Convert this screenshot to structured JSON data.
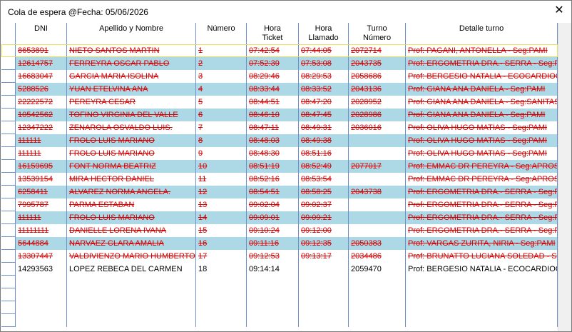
{
  "window": {
    "title": "Cola de espera @Fecha: 05/06/2026",
    "close_glyph": "✕"
  },
  "columns": [
    "DNI",
    "Apellido y Nombre",
    "Número",
    "Hora\nTicket",
    "Hora\nLlamado",
    "Turno\nNúmero",
    "Detalle turno"
  ],
  "rows": [
    {
      "dni": "8653891",
      "nombre": "NIETO SANTOS MARTIN",
      "numero": "1",
      "ticket": "07:42:54",
      "llamado": "07:44:05",
      "turno": "2072714",
      "detalle": "Prof: PAGANI, ANTONELLA - Seg:PAMI",
      "style": "white",
      "status": "cancel",
      "selected": true
    },
    {
      "dni": "12614757",
      "nombre": "FERREYRA OSCAR PABLO",
      "numero": "2",
      "ticket": "07:52:39",
      "llamado": "07:53:08",
      "turno": "2043735",
      "detalle": "Prof: ERGOMETRIA DRA.- SERRA - Seg:PAM",
      "style": "blue",
      "status": "cancel"
    },
    {
      "dni": "16683047",
      "nombre": "GARCIA MARIA ISOLINA",
      "numero": "3",
      "ticket": "08:29:46",
      "llamado": "08:29:53",
      "turno": "2058686",
      "detalle": "Prof: BERGESIO NATALIA - ECOCARDIOGR",
      "style": "white",
      "status": "cancel"
    },
    {
      "dni": "5288526",
      "nombre": "YUAN ETELVINA ANA",
      "numero": "4",
      "ticket": "08:33:44",
      "llamado": "08:33:52",
      "turno": "2043136",
      "detalle": "Prof: GIANA ANA DANIELA - Seg:PAMI",
      "style": "blue",
      "status": "cancel"
    },
    {
      "dni": "22222572",
      "nombre": "PEREYRA CESAR",
      "numero": "5",
      "ticket": "08:44:51",
      "llamado": "08:47:20",
      "turno": "2028952",
      "detalle": "Prof: GIANA ANA DANIELA - Seg:SANITAS",
      "style": "white",
      "status": "cancel"
    },
    {
      "dni": "10542562",
      "nombre": "TOFINO VIRGINIA DEL VALLE",
      "numero": "6",
      "ticket": "08:46:10",
      "llamado": "08:47:45",
      "turno": "2028986",
      "detalle": "Prof: GIANA ANA DANIELA - Seg:PAMI",
      "style": "blue",
      "status": "cancel"
    },
    {
      "dni": "12347222",
      "nombre": "ZENAROLA OSVALDO LUIS.",
      "numero": "7",
      "ticket": "08:47:11",
      "llamado": "08:49:31",
      "turno": "2036016",
      "detalle": "Prof: OLIVA HUGO MATIAS - Seg:PAMI",
      "style": "white",
      "status": "cancel"
    },
    {
      "dni": "111111",
      "nombre": "FROLO LUIS MARIANO",
      "numero": "8",
      "ticket": "08:48:03",
      "llamado": "08:49:38",
      "turno": "",
      "detalle": "Prof: OLIVA HUGO MATIAS - Seg:PAMI",
      "style": "blue",
      "status": "cancel"
    },
    {
      "dni": "111111",
      "nombre": "FROLO LUIS MARIANO",
      "numero": "9",
      "ticket": "08:48:30",
      "llamado": "08:51:16",
      "turno": "",
      "detalle": "Prof: OLIVA HUGO MATIAS - Seg:PAMI",
      "style": "white",
      "status": "cancel"
    },
    {
      "dni": "16159695",
      "nombre": "FONT NORMA BEATRIZ",
      "numero": "10",
      "ticket": "08:51:19",
      "llamado": "08:52:49",
      "turno": "2077017",
      "detalle": "Prof: EMMAC DR PEREYRA - Seg:APROSS",
      "style": "blue",
      "status": "cancel"
    },
    {
      "dni": "13539154",
      "nombre": "MIRA HECTOR DANIEL",
      "numero": "11",
      "ticket": "08:52:16",
      "llamado": "08:53:54",
      "turno": "",
      "detalle": "Prof: EMMAC DR PEREYRA - Seg:APROSS",
      "style": "white",
      "status": "cancel"
    },
    {
      "dni": "6258411",
      "nombre": "ALVAREZ NORMA ANGELA.",
      "numero": "12",
      "ticket": "08:54:51",
      "llamado": "08:58:25",
      "turno": "2043738",
      "detalle": "Prof: ERGOMETRIA DRA.- SERRA - Seg:PAM",
      "style": "blue",
      "status": "cancel"
    },
    {
      "dni": "7995787",
      "nombre": "PARMA ESTABAN",
      "numero": "13",
      "ticket": "09:02:04",
      "llamado": "09:02:37",
      "turno": "",
      "detalle": "Prof: ERGOMETRIA DRA.- SERRA - Seg:PAM",
      "style": "white",
      "status": "cancel"
    },
    {
      "dni": "111111",
      "nombre": "FROLO LUIS MARIANO",
      "numero": "14",
      "ticket": "09:09:01",
      "llamado": "09:09:21",
      "turno": "",
      "detalle": "Prof: ERGOMETRIA DRA.- SERRA - Seg:PAM",
      "style": "blue",
      "status": "cancel"
    },
    {
      "dni": "11111111",
      "nombre": "DANIELLE LORENA IVANA",
      "numero": "15",
      "ticket": "09:10:24",
      "llamado": "09:12:00",
      "turno": "",
      "detalle": "Prof: ERGOMETRIA DRA.- SERRA - Seg:PAM",
      "style": "white",
      "status": "cancel"
    },
    {
      "dni": "5644884",
      "nombre": "NARVAEZ CLARA AMALIA",
      "numero": "16",
      "ticket": "09:11:16",
      "llamado": "09:12:35",
      "turno": "2050383",
      "detalle": "Prof: VARGAS ZURITA, NIRIA - Seg:PAMI",
      "style": "blue",
      "status": "cancel"
    },
    {
      "dni": "13307447",
      "nombre": "VALDIVIENZO MARIO HUMBERTO",
      "numero": "17",
      "ticket": "09:12:53",
      "llamado": "09:13:17",
      "turno": "2034486",
      "detalle": "Prof: BRUNATTO LUCIANA SOLEDAD - Seg",
      "style": "white",
      "status": "cancel"
    },
    {
      "dni": "14293563",
      "nombre": "LOPEZ REBECA DEL CARMEN",
      "numero": "18",
      "ticket": "09:14:14",
      "llamado": "",
      "turno": "2059470",
      "detalle": "Prof: BERGESIO NATALIA - ECOCARDIOG",
      "style": "white",
      "status": "active"
    }
  ],
  "empty_row_count": 4
}
